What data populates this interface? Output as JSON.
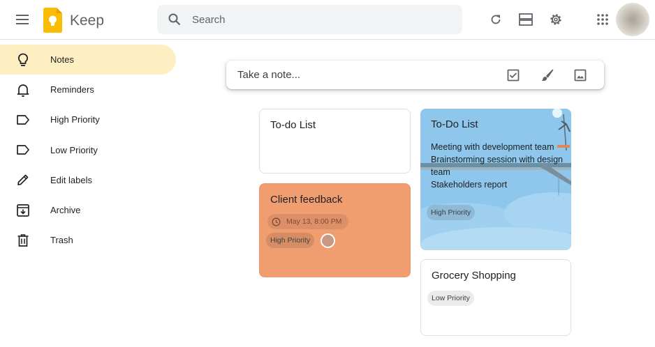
{
  "header": {
    "app_title": "Keep",
    "search_placeholder": "Search"
  },
  "sidebar": {
    "items": [
      {
        "label": "Notes",
        "icon": "lightbulb-icon",
        "active": true
      },
      {
        "label": "Reminders",
        "icon": "bell-icon"
      },
      {
        "label": "High Priority",
        "icon": "label-icon"
      },
      {
        "label": "Low Priority",
        "icon": "label-icon"
      },
      {
        "label": "Edit labels",
        "icon": "pencil-icon"
      },
      {
        "label": "Archive",
        "icon": "archive-icon"
      },
      {
        "label": "Trash",
        "icon": "trash-icon"
      }
    ]
  },
  "take_note": {
    "placeholder": "Take a note..."
  },
  "notes": [
    {
      "title": "To-do List",
      "color": "#ffffff"
    },
    {
      "title": "Client feedback",
      "color": "#f09d70",
      "reminder": "May 13, 8:00 PM",
      "label": "High Priority"
    },
    {
      "title": "To-Do List",
      "color": "#8ec6ec",
      "body": "Meeting with development team\nBrainstorming session with design team\nStakeholders report",
      "label": "High Priority"
    },
    {
      "title": "Grocery Shopping",
      "color": "#ffffff",
      "label": "Low Priority"
    }
  ],
  "colors": {
    "active_nav": "#feefc3",
    "logo_yellow": "#fbbc04"
  }
}
